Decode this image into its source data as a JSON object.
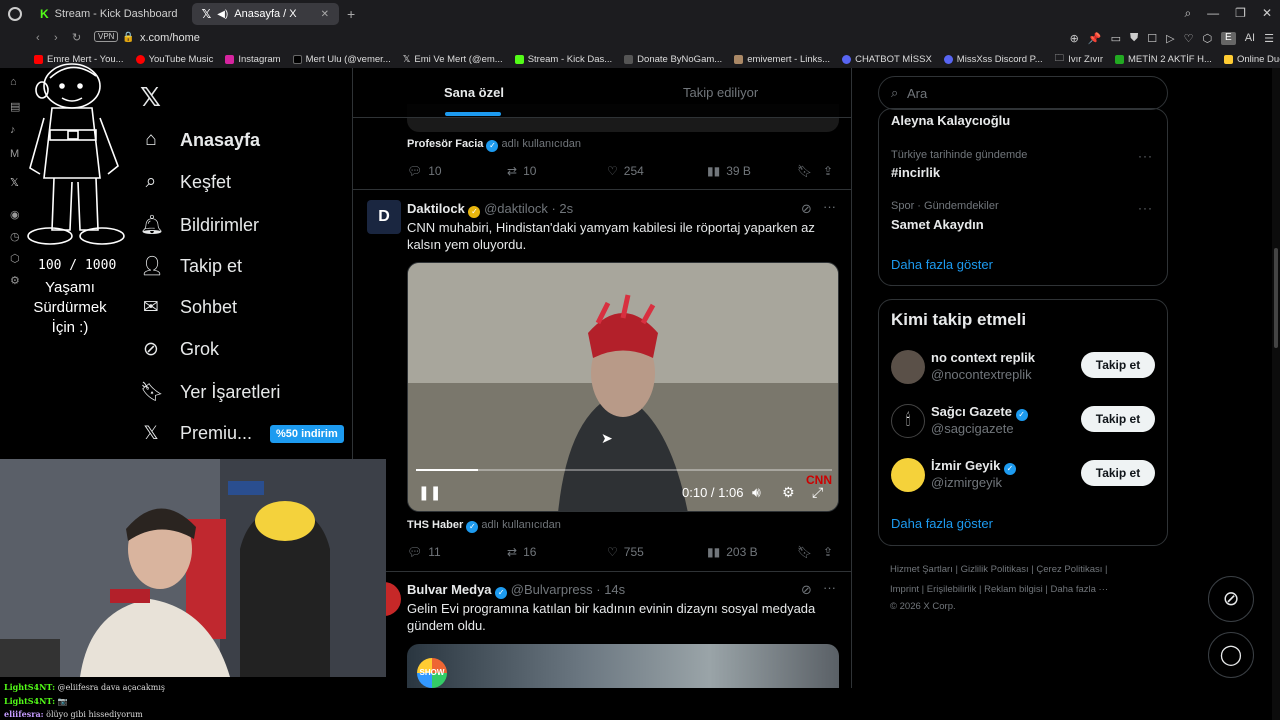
{
  "browser": {
    "tabs": [
      {
        "label": "Stream - Kick Dashboard",
        "active": false
      },
      {
        "label": "Anasayfa / X",
        "active": true
      }
    ],
    "vpn_label": "VPN",
    "url": "x.com/home",
    "ai_label": "AI",
    "profile_initial": "E",
    "bookmarks": [
      "Emre Mert - You...",
      "YouTube Music",
      "Instagram",
      "Mert Ulu (@vemer...",
      "Emi Ve Mert (@em...",
      "Stream - Kick Das...",
      "Donate ByNoGam...",
      "emivemert - Links...",
      "CHATBOT MİSSX",
      "MissXss Discord P...",
      "Ivır Zıvır",
      "METİN 2 AKTİF H...",
      "Online Duck Race..."
    ]
  },
  "overlay": {
    "counter": "100 / 1000",
    "caption": "Yaşamı Sürdürmek İçin :)"
  },
  "nav": {
    "items": [
      {
        "label": "Anasayfa",
        "icon": "home-icon"
      },
      {
        "label": "Keşfet",
        "icon": "search-icon"
      },
      {
        "label": "Bildirimler",
        "icon": "bell-icon"
      },
      {
        "label": "Takip et",
        "icon": "person-add-icon"
      },
      {
        "label": "Sohbet",
        "icon": "mail-icon"
      },
      {
        "label": "Grok",
        "icon": "grok-icon"
      },
      {
        "label": "Yer İşaretleri",
        "icon": "bookmark-icon"
      },
      {
        "label": "Premiu...",
        "icon": "x-premium-icon"
      }
    ],
    "premium_badge": "%50 indirim"
  },
  "timeline": {
    "tabs": [
      "Sana özel",
      "Takip ediliyor"
    ],
    "post1": {
      "via_name": "Profesör Facia",
      "via_suffix": "adlı kullanıcıdan",
      "replies": "10",
      "reposts": "10",
      "likes": "254",
      "views": "39 B"
    },
    "post2": {
      "name": "Daktilock",
      "handle": "@daktilock",
      "time": "· 2s",
      "text": "CNN muhabiri, Hindistan'daki yamyam kabilesi ile röportaj yaparken az kalsın yem oluyordu.",
      "video_time": "0:10 / 1:06",
      "video_progress": 0.15,
      "watermark": "CNN",
      "via_name": "THS Haber",
      "via_suffix": "adlı kullanıcıdan",
      "replies": "11",
      "reposts": "16",
      "likes": "755",
      "views": "203 B"
    },
    "post3": {
      "name": "Bulvar Medya",
      "handle": "@Bulvarpress",
      "time": "· 14s",
      "text": "Gelin Evi programına katılan bir kadının evinin dizaynı sosyal medyada gündem oldu.",
      "thumb_logo": "SHOW"
    }
  },
  "right": {
    "search_placeholder": "Ara",
    "trends": [
      {
        "category": "",
        "name": "Aleyna Kalaycıoğlu"
      },
      {
        "category": "Türkiye tarihinde gündemde",
        "name": "#incirlik"
      },
      {
        "category": "Spor · Gündemdekiler",
        "name": "Samet Akaydın"
      }
    ],
    "show_more": "Daha fazla göster",
    "who_to_follow_title": "Kimi takip etmeli",
    "suggestions": [
      {
        "name": "no context replik",
        "handle": "@nocontextreplik",
        "verified": false
      },
      {
        "name": "Sağcı Gazete",
        "handle": "@sagcigazete",
        "verified": true
      },
      {
        "name": "İzmir Geyik",
        "handle": "@izmirgeyik",
        "verified": true
      }
    ],
    "follow_label": "Takip et",
    "footer_line1": "Hizmet Şartları  |  Gizlilik Politikası  |  Çerez Politikası  |",
    "footer_line2": "Imprint  |  Erişilebilirlik  |  Reklam bilgisi  |  Daha fazla ···",
    "footer_line3": "© 2026 X Corp."
  },
  "chat": [
    {
      "user": "LightS4NT:",
      "msg": "@eliifesra dava açacakmış"
    },
    {
      "user": "LightS4NT:",
      "msg": "📷"
    },
    {
      "user": "eliifesra:",
      "msg": "ölüyo gibi hissediyorum"
    }
  ]
}
